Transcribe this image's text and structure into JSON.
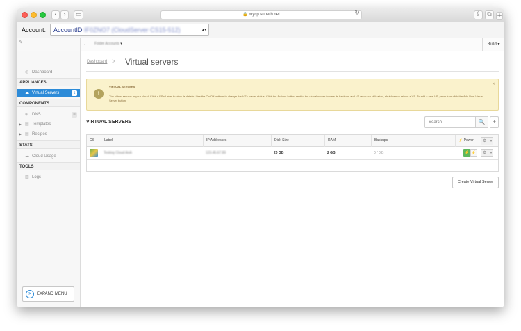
{
  "browser": {
    "url": "mycp.superb.net",
    "back_glyph": "‹",
    "forward_glyph": "›",
    "sidebar_glyph": "▭",
    "reload_glyph": "↻",
    "share_glyph": "⇪",
    "tabs_glyph": "⧉",
    "new_tab_glyph": "+"
  },
  "account": {
    "label": "Account:",
    "prefix": "AccountID",
    "value": "IF0ZNO7 (CloudServer CS15-512)",
    "arrow": "▴▾"
  },
  "subbar": {
    "collapse_glyph": "|←",
    "folder_label": "Folder Accounts",
    "folder_caret": "▾",
    "build_label": "Build",
    "build_caret": "▾",
    "pencil_glyph": "✎"
  },
  "sidebar": {
    "dashboard": "Dashboard",
    "appliances_heading": "APPLIANCES",
    "virtual_servers": "Virtual Servers",
    "virtual_servers_count": "1",
    "components_heading": "COMPONENTS",
    "dns": "DNS",
    "dns_count": "0",
    "templates": "Templates",
    "recipes": "Recipes",
    "stats_heading": "STATS",
    "cloud_usage": "Cloud Usage",
    "tools_heading": "TOOLS",
    "logs": "Logs",
    "expand_menu": "EXPAND MENU",
    "caret_glyph": "▶",
    "expand_glyph": ">"
  },
  "main": {
    "breadcrumb": "Dashboard",
    "breadcrumb_sep": ">",
    "title": "Virtual servers",
    "alert": {
      "icon": "i",
      "title": "VIRTUAL SERVERS",
      "text": "The virtual servers in your cloud. Click a VS's Label to view its details. Use the On/Off buttons to change the VS's power status. Click the Actions button next to the virtual server to view its backups and VS resource utilization, shutdown or reboot a VS. To add a new VS, press + or click the Add New Virtual Server button.",
      "close": "×"
    },
    "section_title": "VIRTUAL SERVERS",
    "search_placeholder": "Search",
    "search_glyph": "🔍",
    "add_glyph": "+",
    "table": {
      "headers": [
        "OS",
        "Label",
        "IP Addresses",
        "Disk Size",
        "RAM",
        "Backups",
        "Power"
      ],
      "power_glyph": "⚡",
      "gear_glyph": "⚙",
      "dropdown_glyph": "▾",
      "rows": [
        {
          "label": "Testing Cloud AnA",
          "ip": "123.45.67.89",
          "disk": "20 GB",
          "ram": "2 GB",
          "backups": "0 / 0 B",
          "power_on": "⚡",
          "power_off": "⚡"
        }
      ]
    },
    "create_button": "Create Virtual Server"
  }
}
